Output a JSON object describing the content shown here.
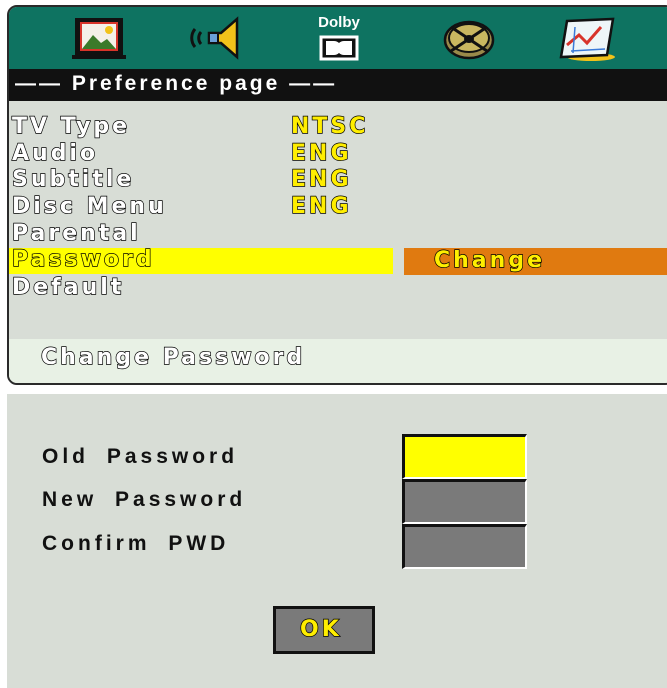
{
  "iconbar": {
    "tabs": [
      {
        "name": "general-setup",
        "icon": "tv-picture-icon"
      },
      {
        "name": "audio-setup",
        "icon": "speaker-icon"
      },
      {
        "name": "dolby-setup",
        "icon": "dolby-icon",
        "label": "Dolby"
      },
      {
        "name": "video-setup",
        "icon": "film-reel-icon"
      },
      {
        "name": "preference-setup",
        "icon": "chart-icon"
      }
    ]
  },
  "page": {
    "title": "—— Preference page ——"
  },
  "menu": {
    "items": [
      {
        "label": "TV Type",
        "value": "NTSC"
      },
      {
        "label": "Audio",
        "value": "ENG"
      },
      {
        "label": "Subtitle",
        "value": "ENG"
      },
      {
        "label": "Disc Menu",
        "value": "ENG"
      },
      {
        "label": "Parental",
        "value": ""
      },
      {
        "label": "Password",
        "value": ""
      },
      {
        "label": "Default",
        "value": ""
      }
    ],
    "selected": "Password",
    "submenu_option": "Change"
  },
  "footer": {
    "hint": "Change Password"
  },
  "dialog": {
    "old_label": "Old Password",
    "new_label": "New Password",
    "confirm_label": "Confirm PWD",
    "ok_label": "OK"
  },
  "colors": {
    "iconbar_bg": "#0e7361",
    "panel_bg": "#d8ddd6",
    "highlight": "#ffff00",
    "submenu_bg": "#e07a10",
    "field_inactive": "#7a7a7a"
  }
}
